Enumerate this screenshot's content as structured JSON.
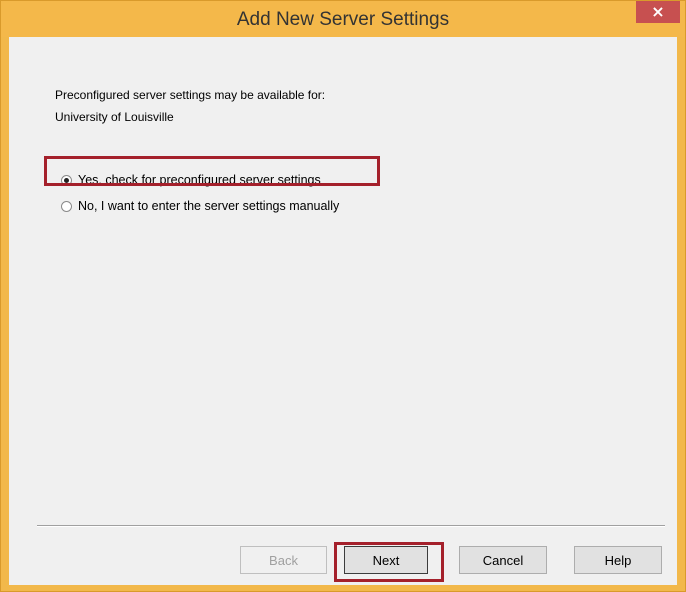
{
  "window": {
    "title": "Add New Server Settings",
    "close_glyph": "×"
  },
  "intro": {
    "line1": "Preconfigured server settings may be available for:",
    "line2": "University of Louisville"
  },
  "options": [
    {
      "label": "Yes, check for preconfigured server settings",
      "selected": true
    },
    {
      "label": "No, I want to enter the server settings manually",
      "selected": false
    }
  ],
  "buttons": {
    "back": "Back",
    "next": "Next",
    "cancel": "Cancel",
    "help": "Help"
  },
  "colors": {
    "titlebar": "#f4b84a",
    "close": "#c75050",
    "highlight": "#a4202b"
  }
}
